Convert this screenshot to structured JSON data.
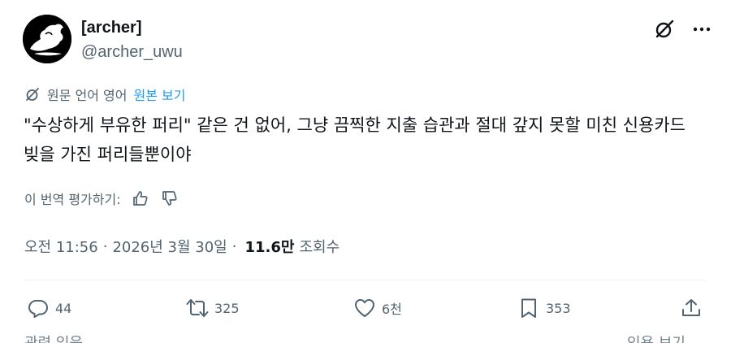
{
  "author": {
    "display_name": "[archer]",
    "handle": "@archer_uwu"
  },
  "header": {
    "grok_icon": "grok-icon",
    "more_icon": "more-icon"
  },
  "translation": {
    "note": "원문 언어 영어",
    "show_original": "원본 보기"
  },
  "tweet": {
    "text": "\"수상하게 부유한 퍼리\" 같은 건 없어, 그냥 끔찍한 지출 습관과 절대 갚지 못할 미친 신용카드 빚을 가진 퍼리들뿐이야"
  },
  "rate_translation": {
    "label": "이 번역 평가하기:"
  },
  "meta": {
    "time": "오전 11:56",
    "separator": "·",
    "date": "2026년 3월 30일",
    "views_count": "11.6만",
    "views_label": "조회수"
  },
  "actions": {
    "replies": "44",
    "reposts": "325",
    "likes": "6천",
    "bookmarks": "353"
  },
  "below": {
    "left": "관련 있음",
    "right": "인용 보기"
  },
  "colors": {
    "text": "#0f1419",
    "secondary": "#536471",
    "link": "#1d9bf0"
  }
}
